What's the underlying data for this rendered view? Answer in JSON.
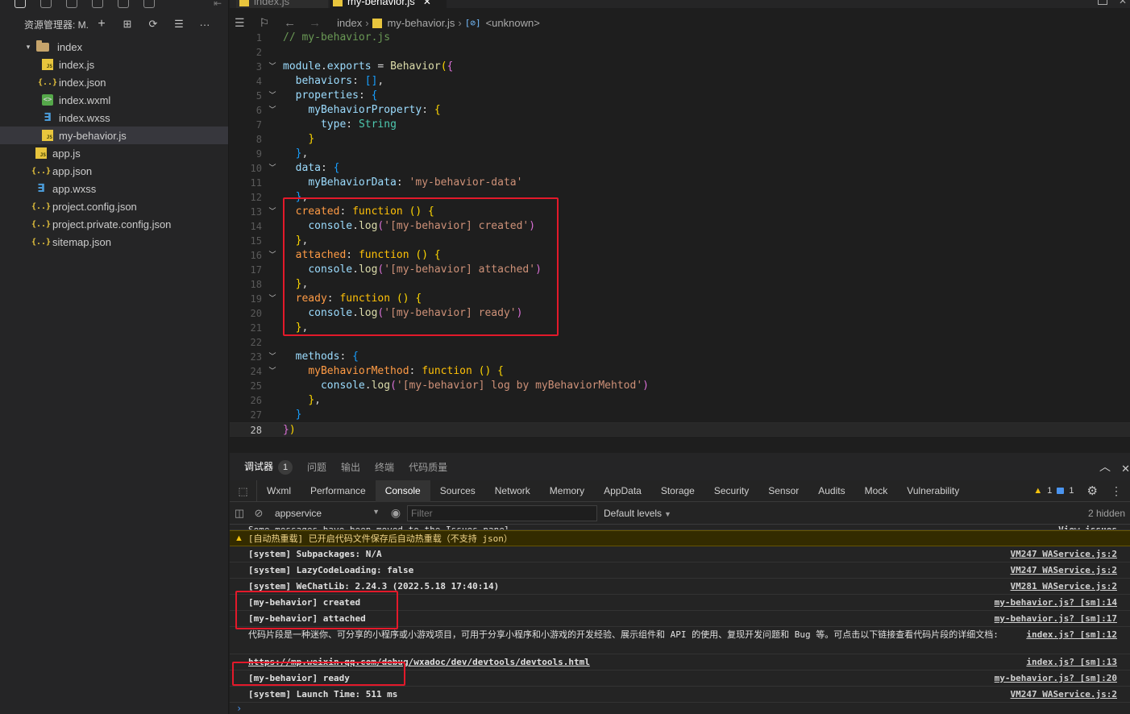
{
  "explorer": {
    "title": "资源管理器: M...",
    "actions": [
      "+",
      "⊞",
      "⟳",
      "☰",
      "···"
    ]
  },
  "tree": [
    {
      "label": "index",
      "type": "folder",
      "level": 0,
      "expanded": true
    },
    {
      "label": "index.js",
      "type": "js",
      "level": 1
    },
    {
      "label": "index.json",
      "type": "json",
      "level": 1
    },
    {
      "label": "index.wxml",
      "type": "wxml",
      "level": 1
    },
    {
      "label": "index.wxss",
      "type": "wxss",
      "level": 1
    },
    {
      "label": "my-behavior.js",
      "type": "js",
      "level": 1,
      "selected": true
    },
    {
      "label": "app.js",
      "type": "js",
      "level": 0
    },
    {
      "label": "app.json",
      "type": "json",
      "level": 0
    },
    {
      "label": "app.wxss",
      "type": "wxss",
      "level": 0
    },
    {
      "label": "project.config.json",
      "type": "json",
      "level": 0
    },
    {
      "label": "project.private.config.json",
      "type": "json",
      "level": 0
    },
    {
      "label": "sitemap.json",
      "type": "json",
      "level": 0
    }
  ],
  "tabs": [
    {
      "label": "index.js",
      "active": false
    },
    {
      "label": "my-behavior.js",
      "active": true
    }
  ],
  "breadcrumb": {
    "folder": "index",
    "file": "my-behavior.js",
    "symbol": "<unknown>"
  },
  "code": {
    "current_line": 28,
    "lines": [
      {
        "n": 1,
        "fold": false,
        "tokens": [
          [
            "c",
            "// my-behavior.js"
          ]
        ]
      },
      {
        "n": 2,
        "fold": false,
        "tokens": []
      },
      {
        "n": 3,
        "fold": true,
        "tokens": [
          [
            "p",
            "module"
          ],
          [
            "o",
            "."
          ],
          [
            "p",
            "exports"
          ],
          [
            "o",
            " = "
          ],
          [
            "f",
            "Behavior"
          ],
          [
            "b",
            "("
          ],
          [
            "b2",
            "{"
          ]
        ]
      },
      {
        "n": 4,
        "fold": false,
        "tokens": [
          [
            "o",
            "  "
          ],
          [
            "p",
            "behaviors"
          ],
          [
            "o",
            ": "
          ],
          [
            "b3",
            "[]"
          ],
          [
            "o",
            ","
          ]
        ]
      },
      {
        "n": 5,
        "fold": true,
        "tokens": [
          [
            "o",
            "  "
          ],
          [
            "p",
            "properties"
          ],
          [
            "o",
            ": "
          ],
          [
            "b3",
            "{"
          ]
        ]
      },
      {
        "n": 6,
        "fold": true,
        "tokens": [
          [
            "o",
            "    "
          ],
          [
            "p",
            "myBehaviorProperty"
          ],
          [
            "o",
            ": "
          ],
          [
            "b",
            "{"
          ]
        ]
      },
      {
        "n": 7,
        "fold": false,
        "tokens": [
          [
            "o",
            "      "
          ],
          [
            "p",
            "type"
          ],
          [
            "o",
            ": "
          ],
          [
            "t",
            "String"
          ]
        ]
      },
      {
        "n": 8,
        "fold": false,
        "tokens": [
          [
            "o",
            "    "
          ],
          [
            "b",
            "}"
          ]
        ]
      },
      {
        "n": 9,
        "fold": false,
        "tokens": [
          [
            "o",
            "  "
          ],
          [
            "b3",
            "}"
          ],
          [
            "o",
            ","
          ]
        ]
      },
      {
        "n": 10,
        "fold": true,
        "tokens": [
          [
            "o",
            "  "
          ],
          [
            "p",
            "data"
          ],
          [
            "o",
            ": "
          ],
          [
            "b3",
            "{"
          ]
        ]
      },
      {
        "n": 11,
        "fold": false,
        "tokens": [
          [
            "o",
            "    "
          ],
          [
            "p",
            "myBehaviorData"
          ],
          [
            "o",
            ": "
          ],
          [
            "s",
            "'my-behavior-data'"
          ]
        ]
      },
      {
        "n": 12,
        "fold": false,
        "tokens": [
          [
            "o",
            "  "
          ],
          [
            "b3",
            "}"
          ],
          [
            "o",
            ","
          ]
        ]
      },
      {
        "n": 13,
        "fold": true,
        "tokens": [
          [
            "o",
            "  "
          ],
          [
            "prop",
            "created"
          ],
          [
            "o",
            ": "
          ],
          [
            "kw",
            "function"
          ],
          [
            "o",
            " "
          ],
          [
            "b",
            "()"
          ],
          [
            "o",
            " "
          ],
          [
            "b",
            "{"
          ]
        ]
      },
      {
        "n": 14,
        "fold": false,
        "tokens": [
          [
            "o",
            "    "
          ],
          [
            "p",
            "console"
          ],
          [
            "o",
            "."
          ],
          [
            "f",
            "log"
          ],
          [
            "b2",
            "("
          ],
          [
            "s",
            "'[my-behavior] created'"
          ],
          [
            "b2",
            ")"
          ]
        ]
      },
      {
        "n": 15,
        "fold": false,
        "tokens": [
          [
            "o",
            "  "
          ],
          [
            "b",
            "}"
          ],
          [
            "o",
            ","
          ]
        ]
      },
      {
        "n": 16,
        "fold": true,
        "tokens": [
          [
            "o",
            "  "
          ],
          [
            "prop",
            "attached"
          ],
          [
            "o",
            ": "
          ],
          [
            "kw",
            "function"
          ],
          [
            "o",
            " "
          ],
          [
            "b",
            "()"
          ],
          [
            "o",
            " "
          ],
          [
            "b",
            "{"
          ]
        ]
      },
      {
        "n": 17,
        "fold": false,
        "tokens": [
          [
            "o",
            "    "
          ],
          [
            "p",
            "console"
          ],
          [
            "o",
            "."
          ],
          [
            "f",
            "log"
          ],
          [
            "b2",
            "("
          ],
          [
            "s",
            "'[my-behavior] attached'"
          ],
          [
            "b2",
            ")"
          ]
        ]
      },
      {
        "n": 18,
        "fold": false,
        "tokens": [
          [
            "o",
            "  "
          ],
          [
            "b",
            "}"
          ],
          [
            "o",
            ","
          ]
        ]
      },
      {
        "n": 19,
        "fold": true,
        "tokens": [
          [
            "o",
            "  "
          ],
          [
            "prop",
            "ready"
          ],
          [
            "o",
            ": "
          ],
          [
            "kw",
            "function"
          ],
          [
            "o",
            " "
          ],
          [
            "b",
            "()"
          ],
          [
            "o",
            " "
          ],
          [
            "b",
            "{"
          ]
        ]
      },
      {
        "n": 20,
        "fold": false,
        "tokens": [
          [
            "o",
            "    "
          ],
          [
            "p",
            "console"
          ],
          [
            "o",
            "."
          ],
          [
            "f",
            "log"
          ],
          [
            "b2",
            "("
          ],
          [
            "s",
            "'[my-behavior] ready'"
          ],
          [
            "b2",
            ")"
          ]
        ]
      },
      {
        "n": 21,
        "fold": false,
        "tokens": [
          [
            "o",
            "  "
          ],
          [
            "b",
            "}"
          ],
          [
            "o",
            ","
          ]
        ]
      },
      {
        "n": 22,
        "fold": false,
        "tokens": []
      },
      {
        "n": 23,
        "fold": true,
        "tokens": [
          [
            "o",
            "  "
          ],
          [
            "p",
            "methods"
          ],
          [
            "o",
            ": "
          ],
          [
            "b3",
            "{"
          ]
        ]
      },
      {
        "n": 24,
        "fold": true,
        "tokens": [
          [
            "o",
            "    "
          ],
          [
            "prop",
            "myBehaviorMethod"
          ],
          [
            "o",
            ": "
          ],
          [
            "kw",
            "function"
          ],
          [
            "o",
            " "
          ],
          [
            "b",
            "()"
          ],
          [
            "o",
            " "
          ],
          [
            "b",
            "{"
          ]
        ]
      },
      {
        "n": 25,
        "fold": false,
        "tokens": [
          [
            "o",
            "      "
          ],
          [
            "p",
            "console"
          ],
          [
            "o",
            "."
          ],
          [
            "f",
            "log"
          ],
          [
            "b2",
            "("
          ],
          [
            "s",
            "'[my-behavior] log by myBehaviorMehtod'"
          ],
          [
            "b2",
            ")"
          ]
        ]
      },
      {
        "n": 26,
        "fold": false,
        "tokens": [
          [
            "o",
            "    "
          ],
          [
            "b",
            "}"
          ],
          [
            "o",
            ","
          ]
        ]
      },
      {
        "n": 27,
        "fold": false,
        "tokens": [
          [
            "o",
            "  "
          ],
          [
            "b3",
            "}"
          ]
        ]
      },
      {
        "n": 28,
        "fold": false,
        "tokens": [
          [
            "b2",
            "}"
          ],
          [
            "b",
            ")"
          ]
        ]
      }
    ]
  },
  "panel": {
    "tabs": [
      {
        "label": "调试器",
        "active": true,
        "badge": "1"
      },
      {
        "label": "问题",
        "active": false
      },
      {
        "label": "输出",
        "active": false
      },
      {
        "label": "终端",
        "active": false
      },
      {
        "label": "代码质量",
        "active": false
      }
    ]
  },
  "devtools": {
    "tabs": [
      {
        "label": "Wxml",
        "active": false
      },
      {
        "label": "Performance",
        "active": false
      },
      {
        "label": "Console",
        "active": true
      },
      {
        "label": "Sources",
        "active": false
      },
      {
        "label": "Network",
        "active": false
      },
      {
        "label": "Memory",
        "active": false
      },
      {
        "label": "AppData",
        "active": false
      },
      {
        "label": "Storage",
        "active": false
      },
      {
        "label": "Security",
        "active": false
      },
      {
        "label": "Sensor",
        "active": false
      },
      {
        "label": "Audits",
        "active": false
      },
      {
        "label": "Mock",
        "active": false
      },
      {
        "label": "Vulnerability",
        "active": false
      }
    ],
    "warning_count": "1",
    "info_count": "1"
  },
  "console_toolbar": {
    "context": "appservice",
    "filter_placeholder": "Filter",
    "levels": "Default levels",
    "hidden": "2 hidden"
  },
  "console": [
    {
      "kind": "cut",
      "msg": "Some messages have been moved to the Issues panel.",
      "src": "View issues"
    },
    {
      "kind": "warning",
      "msg": "[自动热重载] 已开启代码文件保存后自动热重载（不支持 json）",
      "src": ""
    },
    {
      "kind": "log",
      "msg": "[system] Subpackages: N/A",
      "src": "VM247 WAService.js:2"
    },
    {
      "kind": "log",
      "msg": "[system] LazyCodeLoading: false",
      "src": "VM247 WAService.js:2"
    },
    {
      "kind": "log",
      "msg": "[system] WeChatLib: 2.24.3 (2022.5.18 17:40:14)",
      "src": "VM281 WAService.js:2"
    },
    {
      "kind": "log",
      "msg": "[my-behavior] created",
      "src": "my-behavior.js? [sm]:14"
    },
    {
      "kind": "log",
      "msg": "[my-behavior] attached",
      "src": "my-behavior.js? [sm]:17"
    },
    {
      "kind": "tall",
      "msg": "代码片段是一种迷你、可分享的小程序或小游戏项目，可用于分享小程序和小游戏的开发经验、展示组件和 API 的使用、复现开发问题和 Bug 等。可点击以下链接查看代码片段的详细文档:",
      "src": "index.js? [sm]:12"
    },
    {
      "kind": "log",
      "msg": "https://mp.weixin.qq.com/debug/wxadoc/dev/devtools/devtools.html",
      "src": "index.js? [sm]:13"
    },
    {
      "kind": "log",
      "msg": "[my-behavior] ready",
      "src": "my-behavior.js? [sm]:20"
    },
    {
      "kind": "log",
      "msg": "[system] Launch Time: 511 ms",
      "src": "VM247 WAService.js:2"
    }
  ],
  "prompt": "›",
  "colors": {
    "highlight_box": "#e3192a",
    "selected_row": "#37373d",
    "warning_bg": "#332b00"
  }
}
